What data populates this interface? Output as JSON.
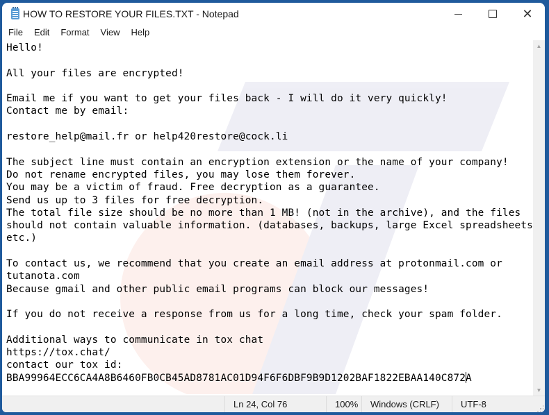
{
  "window": {
    "title": "HOW TO RESTORE YOUR FILES.TXT - Notepad",
    "app_icon": "notepad-icon",
    "controls": {
      "minimize": "minimize-icon",
      "maximize": "maximize-icon",
      "close": "close-icon",
      "close_glyph": "✕"
    }
  },
  "menu": {
    "items": [
      {
        "label": "File"
      },
      {
        "label": "Edit"
      },
      {
        "label": "Format"
      },
      {
        "label": "View"
      },
      {
        "label": "Help"
      }
    ]
  },
  "document": {
    "lines": [
      "Hello!",
      "",
      "All your files are encrypted!",
      "",
      "Email me if you want to get your files back - I will do it very quickly!",
      "Contact me by email:",
      "",
      "restore_help@mail.fr or help420restore@cock.li",
      "",
      "The subject line must contain an encryption extension or the name of your company!",
      "Do not rename encrypted files, you may lose them forever.",
      "You may be a victim of fraud. Free decryption as a guarantee.",
      "Send us up to 3 files for free decryption.",
      "The total file size should be no more than 1 MB! (not in the archive), and the files",
      "should not contain valuable information. (databases, backups, large Excel spreadsheets,",
      "etc.)",
      "",
      "To contact us, we recommend that you create an email address at protonmail.com or",
      "tutanota.com",
      "Because gmail and other public email programs can block our messages!",
      "",
      "If you do not receive a response from us for a long time, check your spam folder.",
      "",
      "Additional ways to communicate in tox chat",
      "https://tox.chat/",
      "contact our tox id:"
    ],
    "last_line_before_caret": "BBA99964ECC6CA4A8B6460FB0CB45AD8781AC01D94F6F6DBF9B9D1202BAF1822EBAA140C872",
    "last_line_after_caret": "A"
  },
  "scrollbar": {
    "up_glyph": "▲",
    "down_glyph": "▼"
  },
  "status": {
    "position": "Ln 24, Col 76",
    "zoom": "100%",
    "line_ending": "Windows (CRLF)",
    "encoding": "UTF-8"
  },
  "colors": {
    "desktop": "#1f5a9c",
    "status_bar": "#f0f0f0"
  }
}
